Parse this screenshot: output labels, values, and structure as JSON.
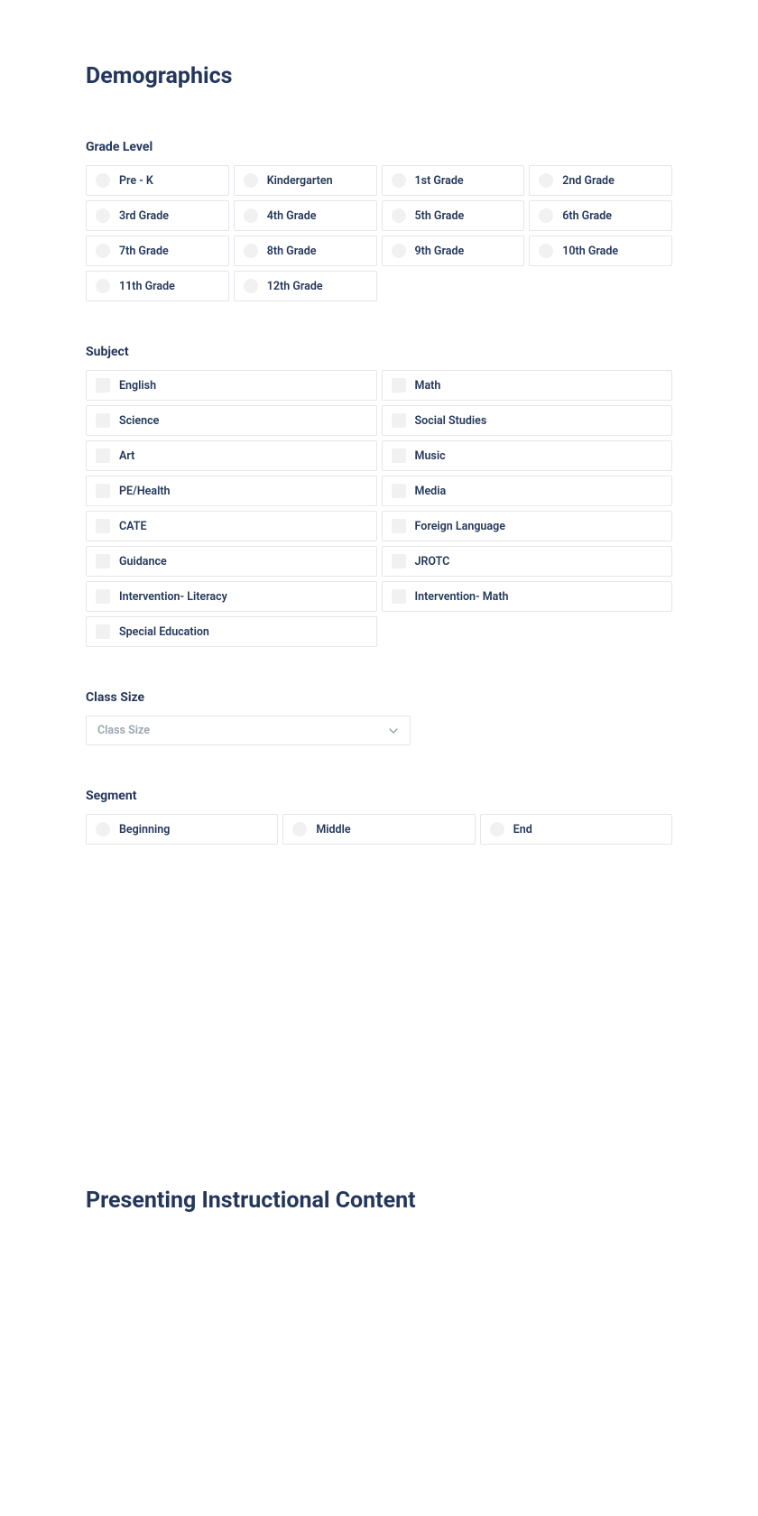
{
  "headings": {
    "demographics": "Demographics",
    "presenting": "Presenting Instructional Content"
  },
  "gradeLevel": {
    "label": "Grade Level",
    "options": [
      "Pre - K",
      "Kindergarten",
      "1st Grade",
      "2nd Grade",
      "3rd Grade",
      "4th Grade",
      "5th Grade",
      "6th Grade",
      "7th Grade",
      "8th Grade",
      "9th Grade",
      "10th Grade",
      "11th Grade",
      "12th Grade"
    ]
  },
  "subject": {
    "label": "Subject",
    "options": [
      "English",
      "Math",
      "Science",
      "Social Studies",
      "Art",
      "Music",
      "PE/Health",
      "Media",
      "CATE",
      "Foreign Language",
      "Guidance",
      "JROTC",
      "Intervention- Literacy",
      "Intervention- Math",
      "Special Education"
    ]
  },
  "classSize": {
    "label": "Class Size",
    "placeholder": "Class Size"
  },
  "segment": {
    "label": "Segment",
    "options": [
      "Beginning",
      "Middle",
      "End"
    ]
  }
}
